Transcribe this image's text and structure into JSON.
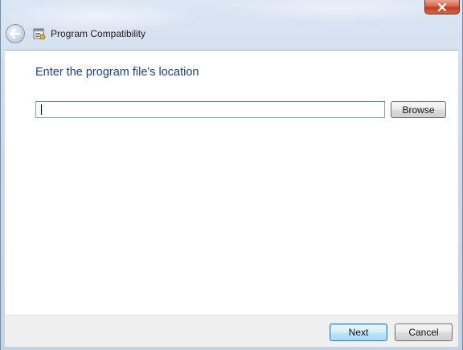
{
  "window": {
    "title": "Program Compatibility",
    "close_label": "✕"
  },
  "titlebar": {
    "back_icon": "back-arrow-icon",
    "app_icon": "program-compatibility-icon"
  },
  "main": {
    "heading": "Enter the program file's location",
    "path_input": {
      "value": "",
      "placeholder": ""
    },
    "browse_label": "Browse"
  },
  "footer": {
    "next_label": "Next",
    "cancel_label": "Cancel"
  },
  "colors": {
    "heading": "#1e3f8a",
    "close_button": "#c23f22",
    "default_button_border": "#3c7fb1"
  }
}
